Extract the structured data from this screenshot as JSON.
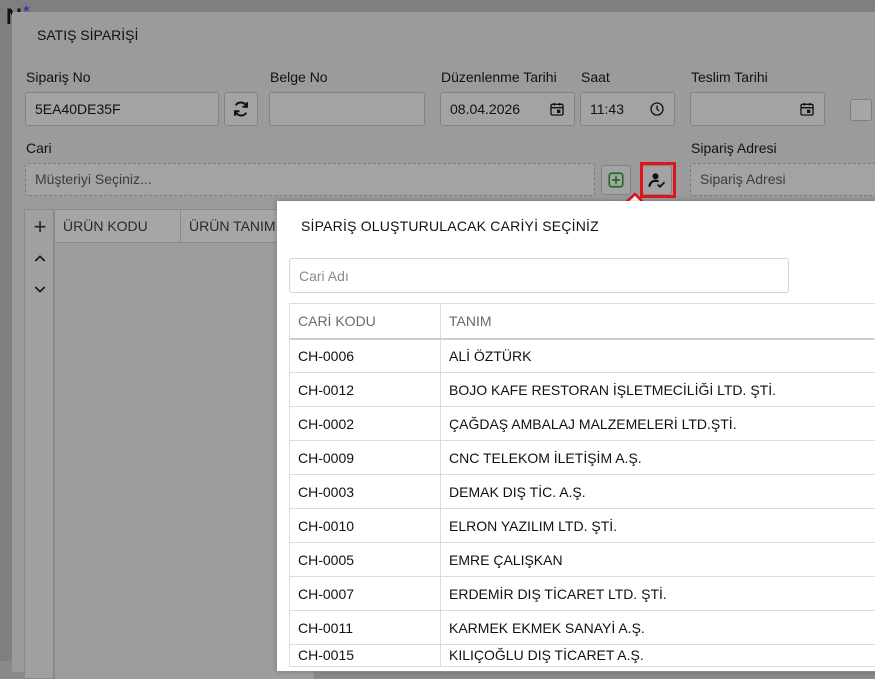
{
  "colors": {
    "highlight": "#e0151c",
    "add_green": "#2e8b2e"
  },
  "order_dialog": {
    "title": "SATIŞ SİPARİŞİ",
    "fields": {
      "siparis_no": {
        "label": "Sipariş No",
        "value": "5EA40DE35F"
      },
      "belge_no": {
        "label": "Belge No",
        "value": ""
      },
      "duzenlenme_tarihi": {
        "label": "Düzenlenme Tarihi",
        "value": "08.04.2026"
      },
      "saat": {
        "label": "Saat",
        "value": "11:43"
      },
      "teslim_tarihi": {
        "label": "Teslim Tarihi",
        "value": ""
      },
      "cari": {
        "label": "Cari",
        "placeholder": "Müşteriyi Seçiniz..."
      },
      "siparis_adresi": {
        "label": "Sipariş Adresi",
        "placeholder": "Sipariş Adresi"
      }
    },
    "icons": {
      "refresh": "refresh-icon",
      "calendar": "calendar-icon",
      "clock": "clock-icon",
      "add": "plus-square-icon",
      "select_customer": "user-check-icon"
    },
    "grid": {
      "columns": [
        "ÜRÜN KODU",
        "ÜRÜN TANIMI"
      ],
      "side_buttons": [
        "+",
        "⌃",
        "⌄"
      ]
    }
  },
  "customer_modal": {
    "title": "SİPARİŞ OLUŞTURULACAK CARİYİ SEÇİNİZ",
    "search_placeholder": "Cari Adı",
    "columns": [
      "CARİ KODU",
      "TANIM"
    ],
    "rows": [
      {
        "code": "CH-0006",
        "name": "ALİ ÖZTÜRK"
      },
      {
        "code": "CH-0012",
        "name": "BOJO KAFE RESTORAN İŞLETMECİLİĞİ LTD. ŞTİ."
      },
      {
        "code": "CH-0002",
        "name": "ÇAĞDAŞ AMBALAJ MALZEMELERİ LTD.ŞTİ."
      },
      {
        "code": "CH-0009",
        "name": "CNC TELEKOM İLETİŞİM A.Ş."
      },
      {
        "code": "CH-0003",
        "name": "DEMAK DIŞ TİC. A.Ş."
      },
      {
        "code": "CH-0010",
        "name": "ELRON YAZILIM LTD. ŞTİ."
      },
      {
        "code": "CH-0005",
        "name": "EMRE ÇALIŞKAN"
      },
      {
        "code": "CH-0007",
        "name": "ERDEMİR DIŞ TİCARET LTD. ŞTİ."
      },
      {
        "code": "CH-0011",
        "name": "KARMEK EKMEK SANAYİ A.Ş."
      },
      {
        "code": "CH-0015",
        "name": "KILIÇOĞLU DIŞ TİCARET A.Ş."
      }
    ]
  }
}
